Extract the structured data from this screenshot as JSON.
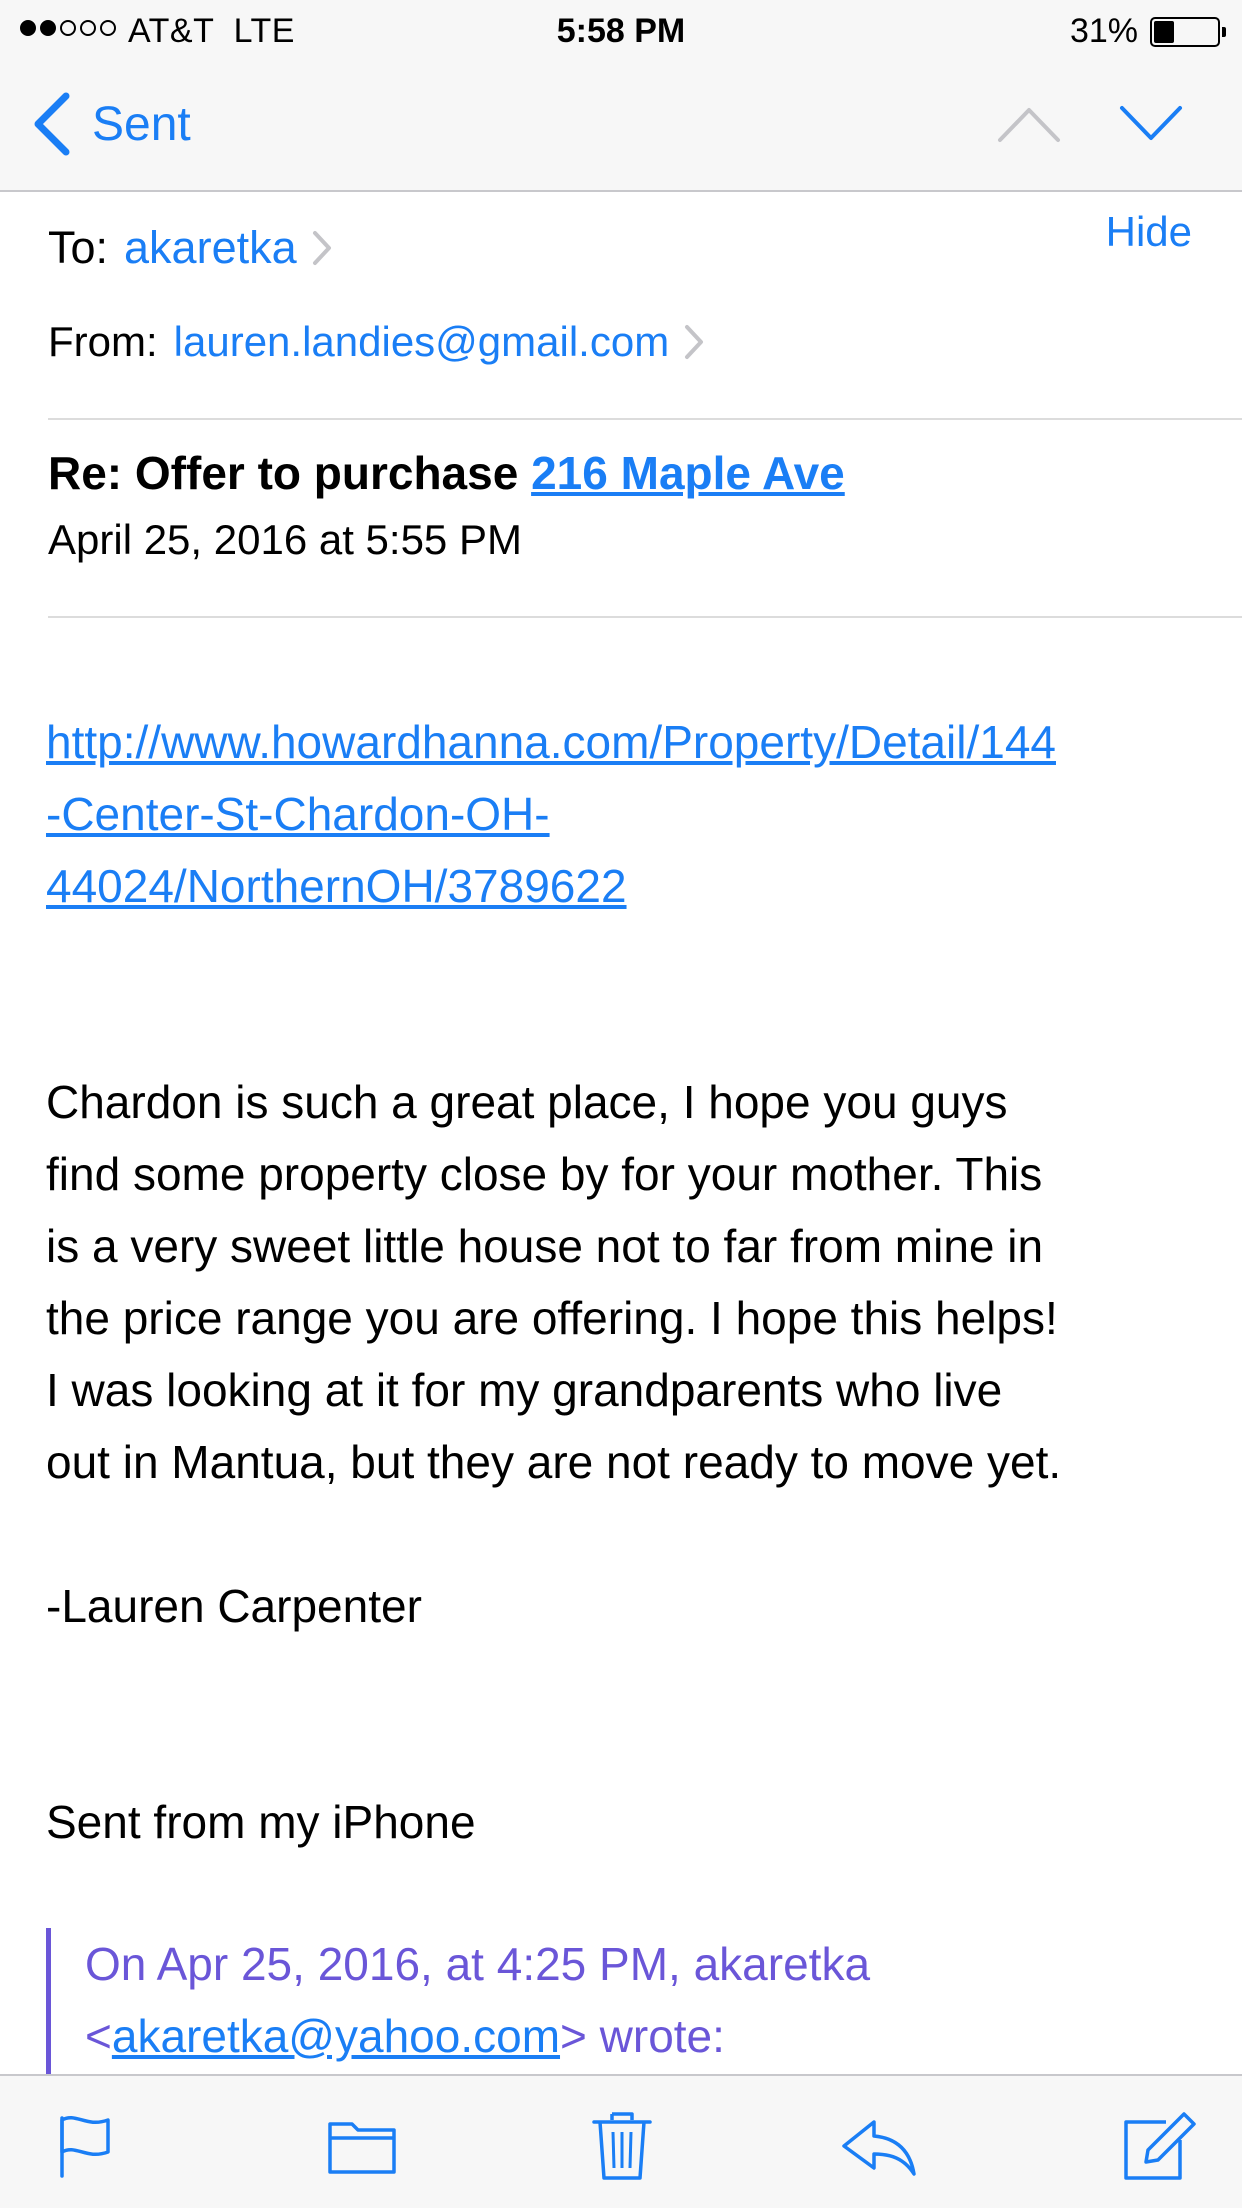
{
  "status_bar": {
    "signal_dots": [
      true,
      true,
      false,
      false,
      false
    ],
    "carrier": "AT&T  LTE",
    "time": "5:58 PM",
    "battery_percent": "31%",
    "battery_level": 0.31
  },
  "nav": {
    "back_label": "Sent",
    "prev_icon": "chevron-up-icon",
    "next_icon": "chevron-down-icon"
  },
  "header": {
    "to_label": "To:",
    "to_value": "akaretka",
    "from_label": "From:",
    "from_value": "lauren.landies@gmail.com",
    "hide_label": "Hide",
    "subject_prefix": "Re: Offer to purchase ",
    "subject_address": "216 Maple Ave",
    "date": "April 25, 2016 at 5:55 PM"
  },
  "body": {
    "url_line1": "http://www.howardhanna.com/Property/Detail/144",
    "url_line2": "-Center-St-Chardon-OH-",
    "url_line3": "44024/NorthernOH/3789622",
    "lines": [
      "Chardon is such a great place, I hope you guys",
      "find some property close by for your mother. This",
      "is a very sweet little house not to far from mine in",
      "the price range you are offering. I hope this helps!",
      "I was looking at it for my grandparents who live",
      "out in Mantua, but they are not ready to move yet."
    ],
    "signature": "-Lauren Carpenter",
    "sent_from": "Sent from my iPhone",
    "quote_intro": "On Apr 25, 2016, at 4:25 PM, akaretka",
    "quote_lt": "<",
    "quote_email": "akaretka@yahoo.com",
    "quote_tail": "> wrote:"
  },
  "toolbar": {
    "icons": [
      "flag-icon",
      "folder-icon",
      "trash-icon",
      "reply-icon",
      "compose-icon"
    ]
  },
  "colors": {
    "accent": "#1a7ef5",
    "quote": "#6a56d8",
    "bar_bg": "#f7f7f7"
  }
}
